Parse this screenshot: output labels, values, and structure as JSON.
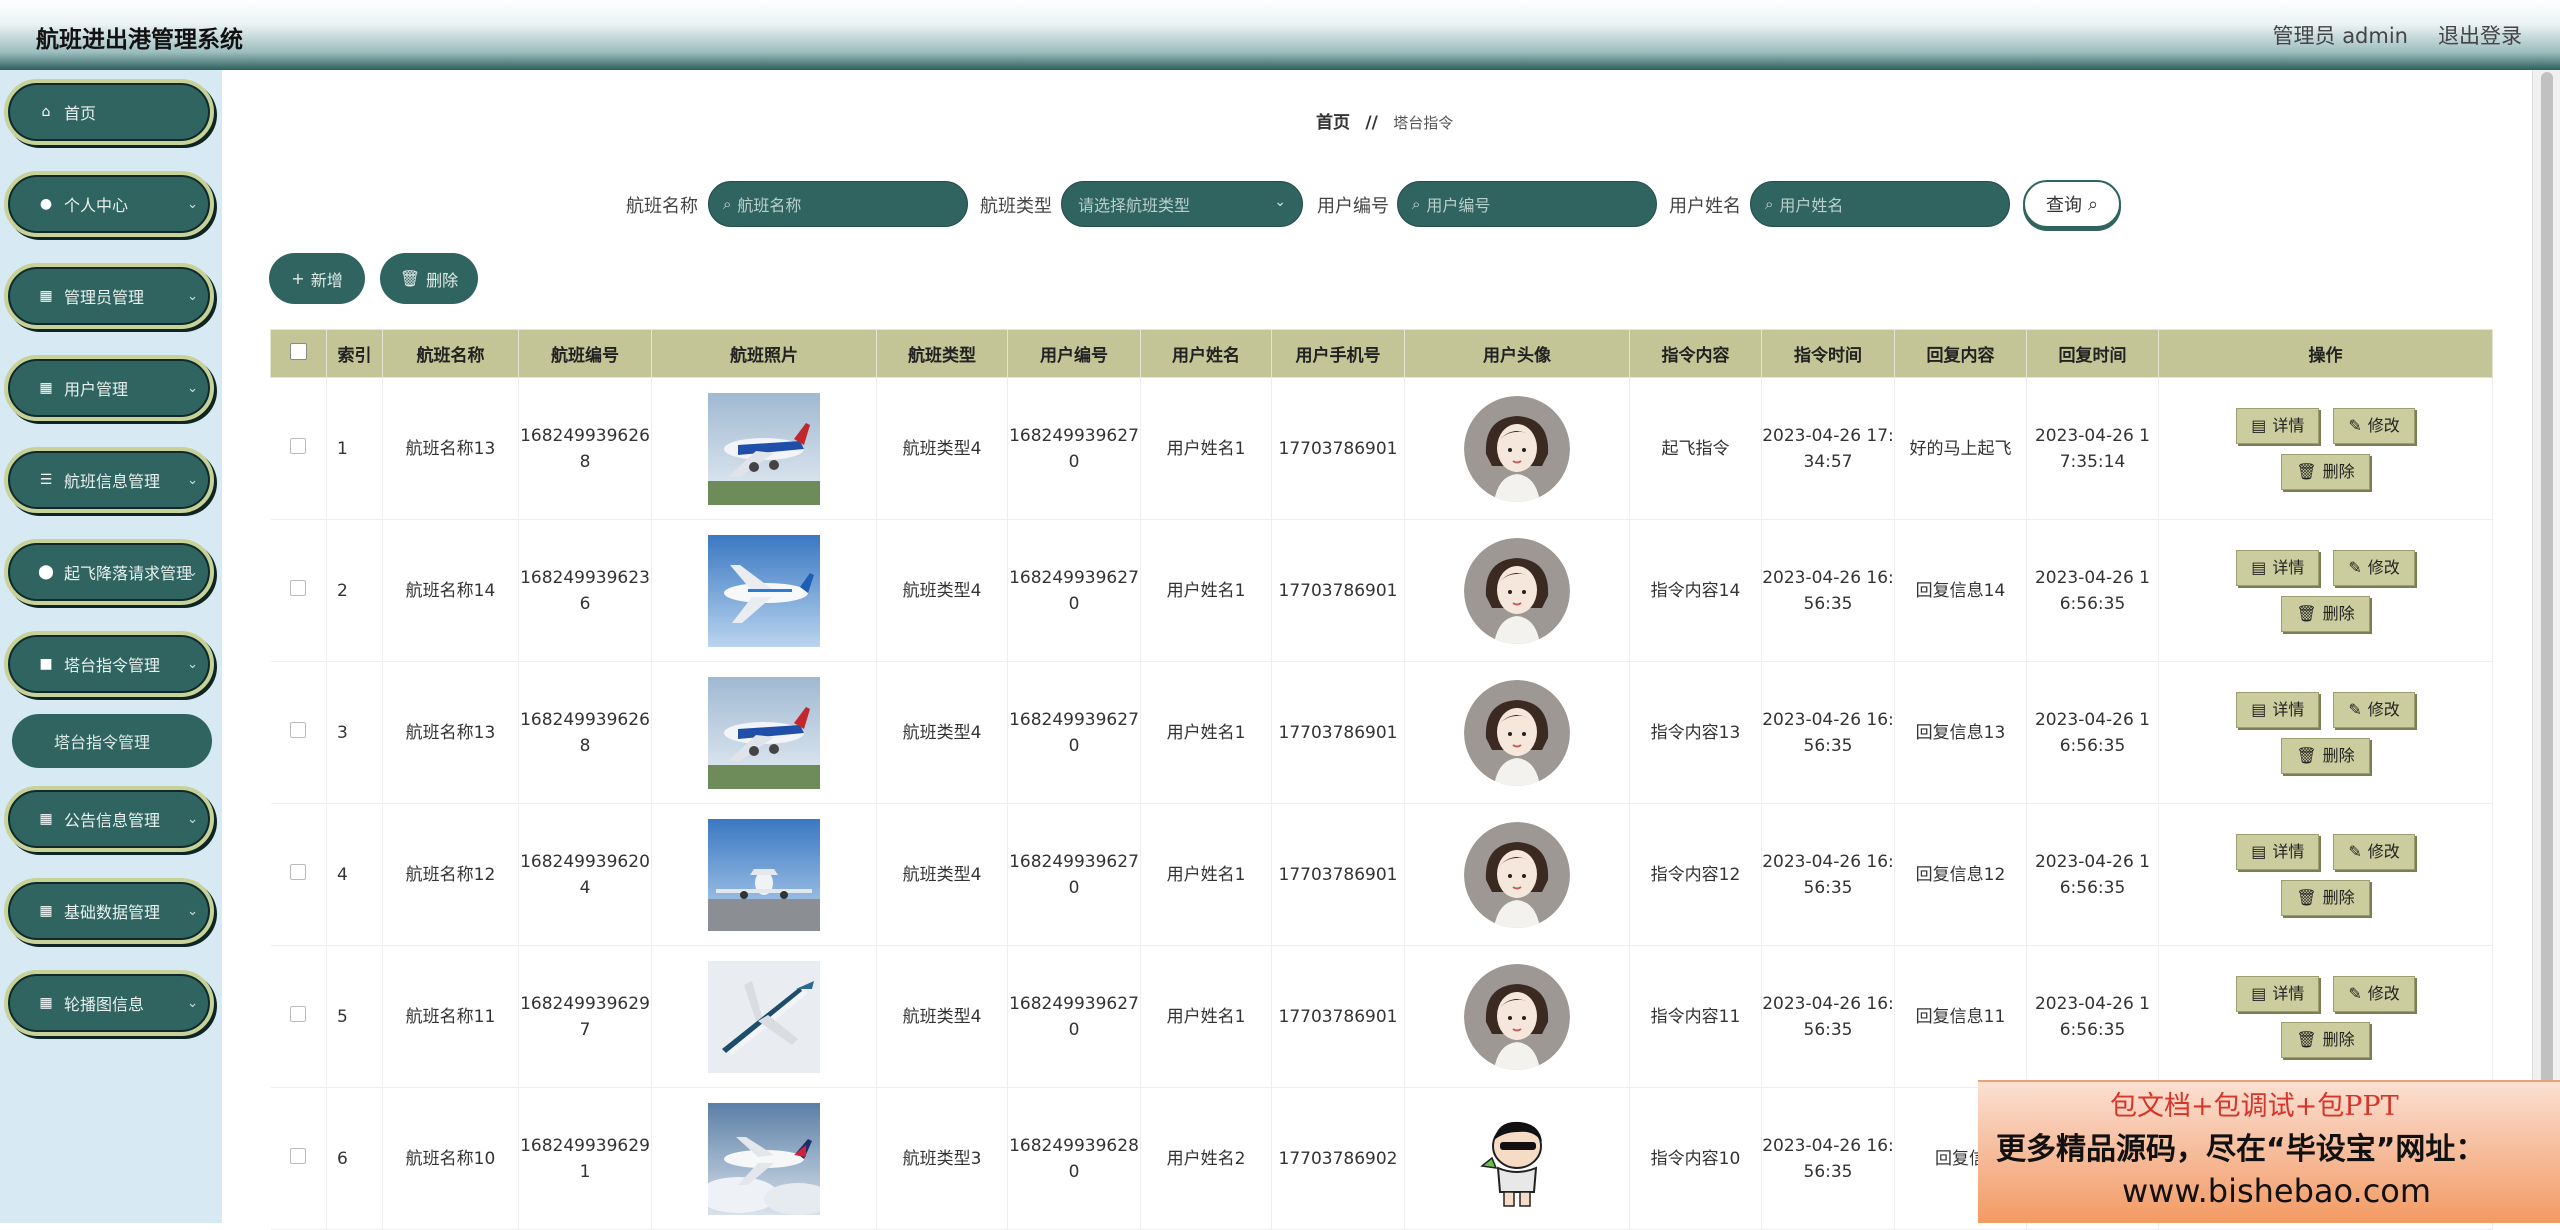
{
  "header": {
    "title": "航班进出港管理系统",
    "user_label": "管理员 admin",
    "logout_label": "退出登录"
  },
  "sidebar": {
    "items": [
      {
        "label": "首页",
        "icon": "home-icon"
      },
      {
        "label": "个人中心",
        "icon": "user-icon"
      },
      {
        "label": "管理员管理",
        "icon": "grid-icon"
      },
      {
        "label": "用户管理",
        "icon": "grid-icon"
      },
      {
        "label": "航班信息管理",
        "icon": "list-icon"
      },
      {
        "label": "起飞降落请求管理",
        "icon": "location-icon"
      },
      {
        "label": "塔台指令管理",
        "icon": "briefcase-icon"
      },
      {
        "label": "公告信息管理",
        "icon": "grid-icon"
      },
      {
        "label": "基础数据管理",
        "icon": "grid-icon"
      },
      {
        "label": "轮播图信息",
        "icon": "grid-icon"
      }
    ],
    "submenu_active": "塔台指令管理"
  },
  "breadcrumb": {
    "home": "首页",
    "separator": "//",
    "current": "塔台指令"
  },
  "search": {
    "flight_name_label": "航班名称",
    "flight_name_placeholder": "航班名称",
    "flight_type_label": "航班类型",
    "flight_type_placeholder": "请选择航班类型",
    "user_no_label": "用户编号",
    "user_no_placeholder": "用户编号",
    "user_name_label": "用户姓名",
    "user_name_placeholder": "用户姓名",
    "query_label": "查询"
  },
  "actions": {
    "add_label": "新增",
    "delete_label": "删除"
  },
  "table": {
    "headers": [
      "索引",
      "航班名称",
      "航班编号",
      "航班照片",
      "航班类型",
      "用户编号",
      "用户姓名",
      "用户手机号",
      "用户头像",
      "指令内容",
      "指令时间",
      "回复内容",
      "回复时间",
      "操作"
    ],
    "rows": [
      {
        "index": "1",
        "flight_name": "航班名称13",
        "flight_no": "1682499396268",
        "flight_type": "航班类型4",
        "user_no": "1682499396270",
        "user_name": "用户姓名1",
        "phone": "17703786901",
        "command": "起飞指令",
        "command_time": "2023-04-26 17:34:57",
        "reply": "好的马上起飞",
        "reply_time": "2023-04-26 17:35:14"
      },
      {
        "index": "2",
        "flight_name": "航班名称14",
        "flight_no": "1682499396236",
        "flight_type": "航班类型4",
        "user_no": "1682499396270",
        "user_name": "用户姓名1",
        "phone": "17703786901",
        "command": "指令内容14",
        "command_time": "2023-04-26 16:56:35",
        "reply": "回复信息14",
        "reply_time": "2023-04-26 16:56:35"
      },
      {
        "index": "3",
        "flight_name": "航班名称13",
        "flight_no": "1682499396268",
        "flight_type": "航班类型4",
        "user_no": "1682499396270",
        "user_name": "用户姓名1",
        "phone": "17703786901",
        "command": "指令内容13",
        "command_time": "2023-04-26 16:56:35",
        "reply": "回复信息13",
        "reply_time": "2023-04-26 16:56:35"
      },
      {
        "index": "4",
        "flight_name": "航班名称12",
        "flight_no": "1682499396204",
        "flight_type": "航班类型4",
        "user_no": "1682499396270",
        "user_name": "用户姓名1",
        "phone": "17703786901",
        "command": "指令内容12",
        "command_time": "2023-04-26 16:56:35",
        "reply": "回复信息12",
        "reply_time": "2023-04-26 16:56:35"
      },
      {
        "index": "5",
        "flight_name": "航班名称11",
        "flight_no": "1682499396297",
        "flight_type": "航班类型4",
        "user_no": "1682499396270",
        "user_name": "用户姓名1",
        "phone": "17703786901",
        "command": "指令内容11",
        "command_time": "2023-04-26 16:56:35",
        "reply": "回复信息11",
        "reply_time": "2023-04-26 16:56:35"
      },
      {
        "index": "6",
        "flight_name": "航班名称10",
        "flight_no": "1682499396291",
        "flight_type": "航班类型3",
        "user_no": "1682499396280",
        "user_name": "用户姓名2",
        "phone": "17703786902",
        "command": "指令内容10",
        "command_time": "2023-04-26 16:56:35",
        "reply": "回复信",
        "reply_time": ""
      }
    ],
    "op_detail": "详情",
    "op_edit": "修改",
    "op_delete": "删除"
  },
  "promo": {
    "line1": "包文档+包调试+包PPT",
    "line2": "更多精品源码，尽在“毕设宝”网址：",
    "line3": "www.bishebao.com"
  },
  "colors": {
    "primary": "#2f6461",
    "table_header": "#c3c596",
    "button_olive": "#cbcd9f",
    "sidebar_bg": "#d7eaf3"
  }
}
